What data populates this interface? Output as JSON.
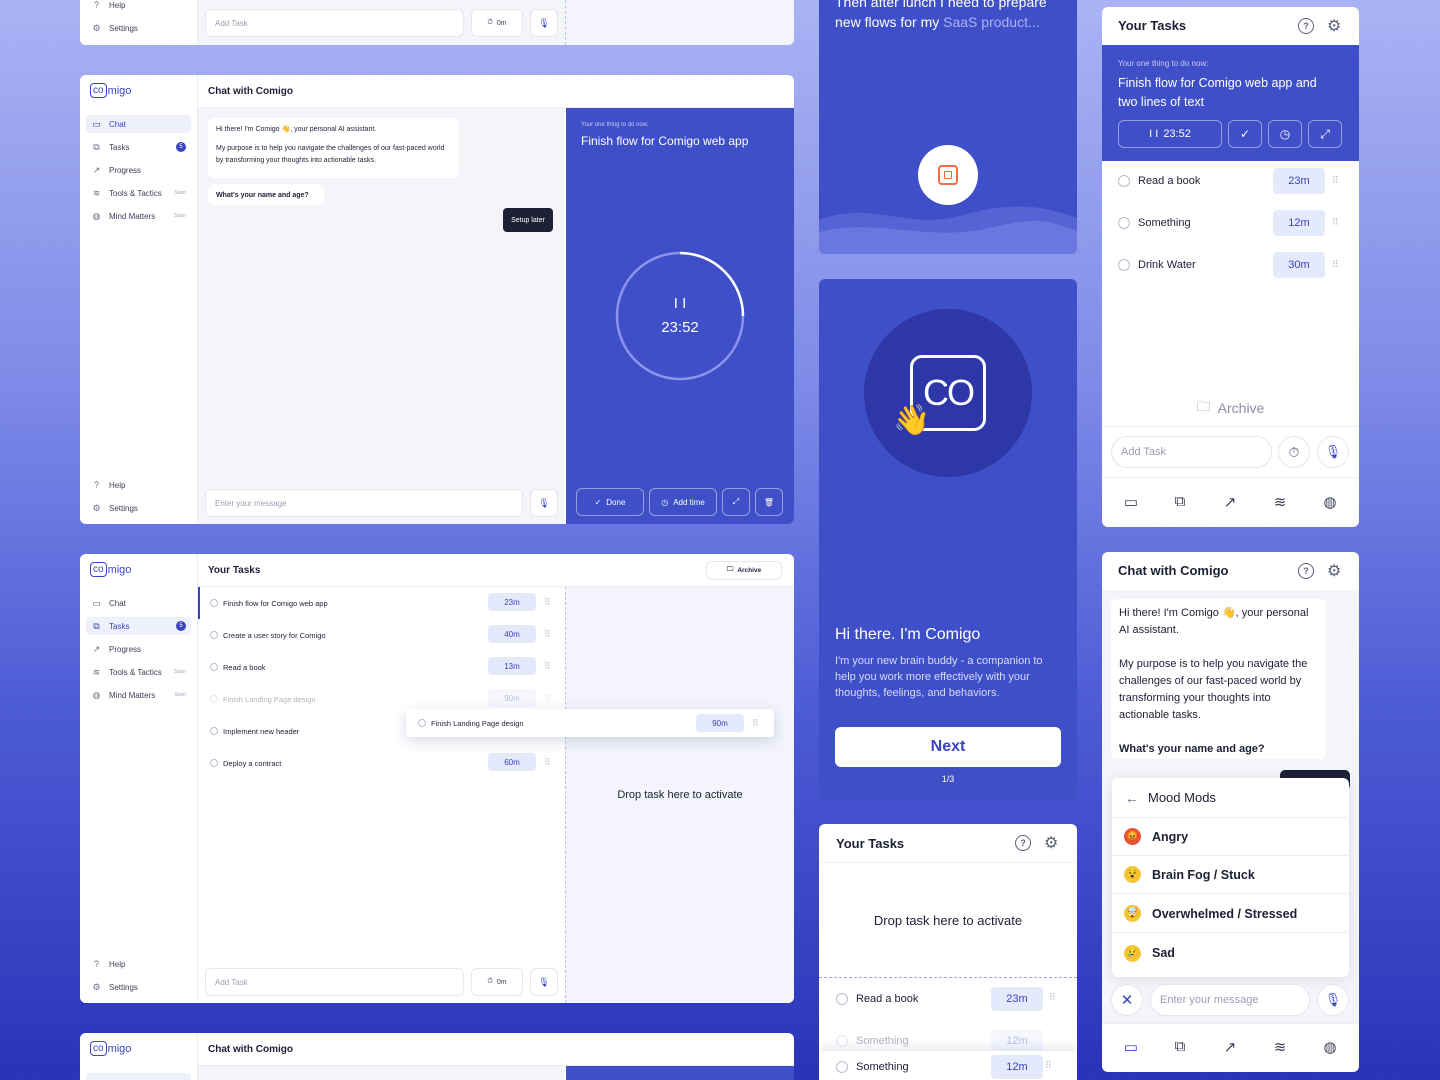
{
  "app": {
    "logo_prefix": "co",
    "logo_suffix": "migo",
    "help": "Help",
    "settings": "Settings"
  },
  "nav": {
    "chat": "Chat",
    "tasks": "Tasks",
    "tasks_badge": "5",
    "progress": "Progress",
    "tools": "Tools & Tactics",
    "mind": "Mind Matters",
    "soon": "Soon"
  },
  "top": {
    "add_task": "Add Task",
    "timer": "0m"
  },
  "chat": {
    "title": "Chat with Comigo",
    "greeting": "Hi there! I'm Comigo 👋, your personal AI assistant.",
    "purpose": "My purpose is to help you navigate the challenges of our fast-paced world by transforming your thoughts into actionable tasks.",
    "question": "What's your name and age?",
    "setup_later": "Setup later",
    "input_placeholder": "Enter your message"
  },
  "focus": {
    "label": "Your one thing to do now:",
    "task": "Finish flow for Comigo web app",
    "pause": "I I",
    "time": "23:52",
    "done": "Done",
    "add_time": "Add time"
  },
  "tasks": {
    "title": "Your Tasks",
    "archive": "Archive",
    "drop_text": "Drop task here to activate",
    "add_task": "Add Task",
    "timer": "0m",
    "items": [
      {
        "name": "Finish flow for Comigo web app",
        "time": "23m"
      },
      {
        "name": "Create a user story for Comigo",
        "time": "40m"
      },
      {
        "name": "Read a book",
        "time": "13m"
      },
      {
        "name": "Finish Landing Page design",
        "time": "90m"
      },
      {
        "name": "Implement new header",
        "time": ""
      },
      {
        "name": "Deploy a contract",
        "time": "60m"
      }
    ],
    "dragging": {
      "name": "Finish Landing Page design",
      "time": "90m"
    }
  },
  "onboard": {
    "top_text_line1": "Then after lunch I need to prepare",
    "top_text_line2_a": "new flows for my ",
    "top_text_line2_b": "SaaS product...",
    "logo": "CO",
    "title": "Hi there. I'm Comigo",
    "body": "I'm your new brain buddy - a companion to help you work more effectively with your thoughts, feelings, and behaviors.",
    "next": "Next",
    "page": "1/3"
  },
  "mobile_tasks": {
    "title": "Your Tasks",
    "label": "Your one thing to do now:",
    "task": "Finish flow for Comigo web app and two lines of text",
    "pause": "I I",
    "time": "23:52",
    "items": [
      {
        "name": "Read a book",
        "time": "23m"
      },
      {
        "name": "Something",
        "time": "12m"
      },
      {
        "name": "Drink Water",
        "time": "30m"
      }
    ],
    "archive": "Archive",
    "add_task": "Add Task"
  },
  "mobile_tasks2": {
    "title": "Your Tasks",
    "drop_text": "Drop task here to activate",
    "items": [
      {
        "name": "Read a book",
        "time": "23m"
      },
      {
        "name": "Something",
        "time": "12m"
      },
      {
        "name": "Something",
        "time": "12m"
      }
    ]
  },
  "mobile_chat": {
    "title": "Chat with Comigo",
    "greeting": "Hi there! I'm Comigo 👋, your personal AI assistant.",
    "purpose": "My purpose is to help you navigate the challenges of our fast-paced world by transforming your thoughts into actionable tasks.",
    "question": "What's your name and age?",
    "mood_title": "Mood Mods",
    "moods": [
      "Angry",
      "Brain Fog / Stuck",
      "Overwhelmed / Stressed",
      "Sad"
    ],
    "input_placeholder": "Enter your message"
  },
  "colors": {
    "primary": "#3a44c0",
    "focus_bg": "#3f4fc7",
    "pill_bg": "#e5e9fc"
  }
}
